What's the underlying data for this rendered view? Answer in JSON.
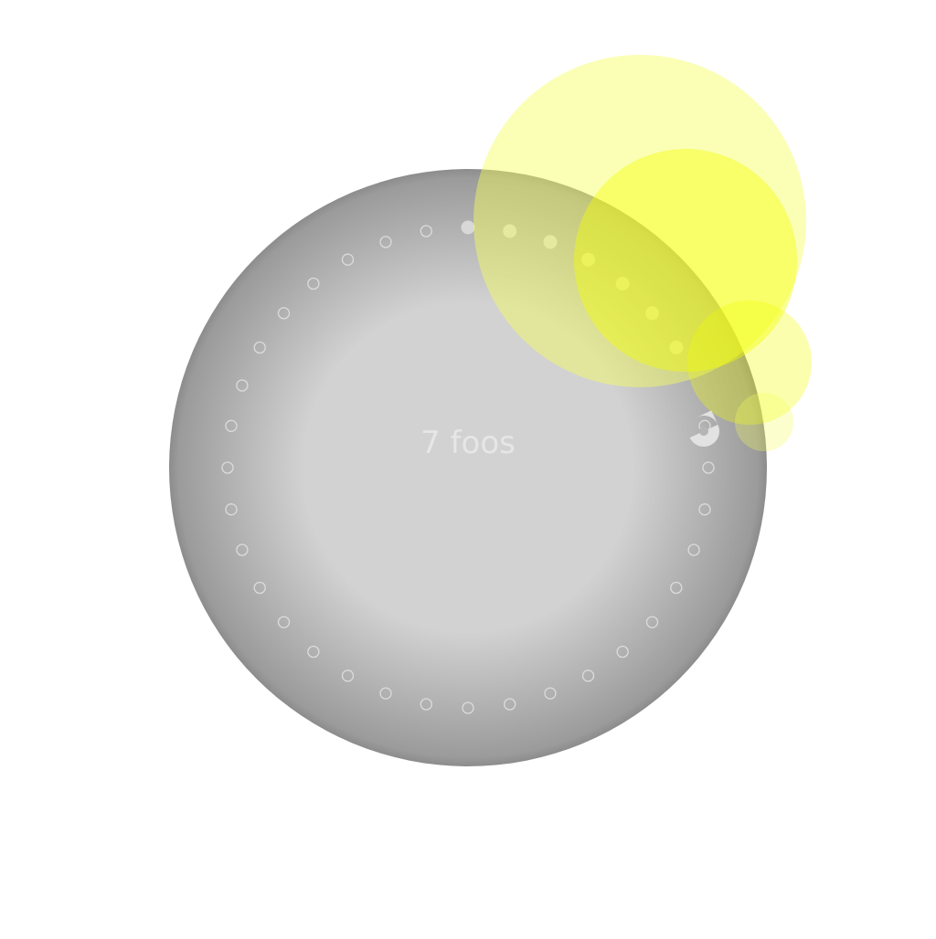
{
  "dial": {
    "label": "7 foos",
    "count": 7,
    "total_steps": 36,
    "label_color": "#e6e6e6",
    "face_inner_color": "#d2d2d2",
    "face_outer_color": "#9b9b9b",
    "filled_dot_color": "#d8d8d8",
    "empty_dot_color": "#dcdcdc",
    "handle_color": "#e2e2e2"
  },
  "glow": {
    "color_light": "#f6ff5a",
    "color_strong": "#f4ff00"
  },
  "icons": {
    "handle": "drag-handle-icon"
  }
}
